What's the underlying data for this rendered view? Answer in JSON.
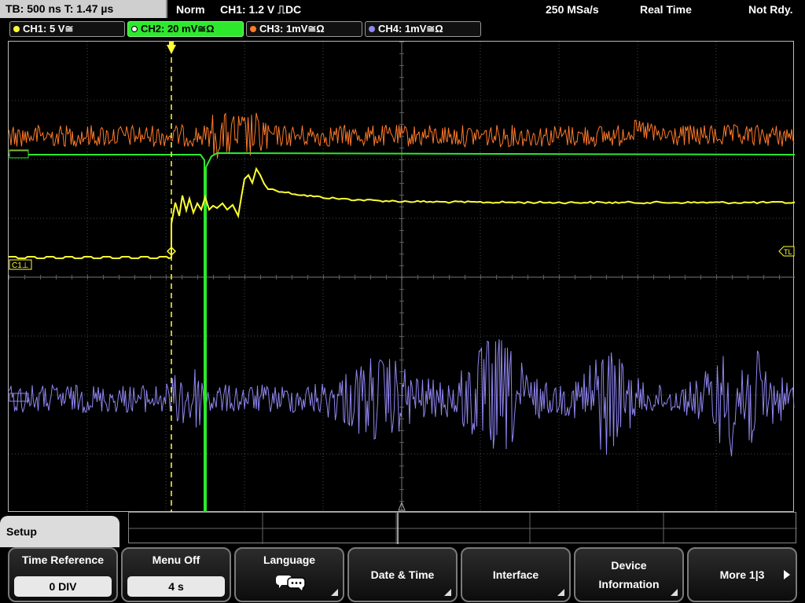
{
  "status_bar": {
    "timebase": "TB: 500 ns  T: 1.47 µs",
    "mode": "Norm",
    "trigger": "CH1: 1.2 V ⎍DC",
    "sample_rate": "250 MSa/s",
    "acq_mode": "Real Time",
    "state": "Not Rdy."
  },
  "channels": [
    {
      "label": "CH1: 5 V≅",
      "color": "#ffff33"
    },
    {
      "label": "CH2: 20 mV≅Ω",
      "color": "#2ee82e"
    },
    {
      "label": "CH3: 1mV≅Ω",
      "color": "#ff7a29"
    },
    {
      "label": "CH4: 1mV≅Ω",
      "color": "#8f86f0"
    }
  ],
  "markers": {
    "ch1": "C1⊥",
    "trigger_level": "TL"
  },
  "colors": {
    "ch1": "#ffff33",
    "ch2": "#2ee82e",
    "ch3": "#ff7a29",
    "ch4": "#8f86f0",
    "grid": "#555555"
  },
  "menu": {
    "title": "Setup",
    "softkeys": [
      {
        "label": "Time Reference",
        "value": "0 DIV"
      },
      {
        "label": "Menu Off",
        "value": "4 s"
      },
      {
        "label": "Language",
        "icon": "speech-bubbles-icon"
      },
      {
        "label": "Date & Time"
      },
      {
        "label": "Interface"
      },
      {
        "label": "Device Information"
      },
      {
        "label": "More 1|3",
        "icon": "play-arrow-icon"
      }
    ]
  }
}
